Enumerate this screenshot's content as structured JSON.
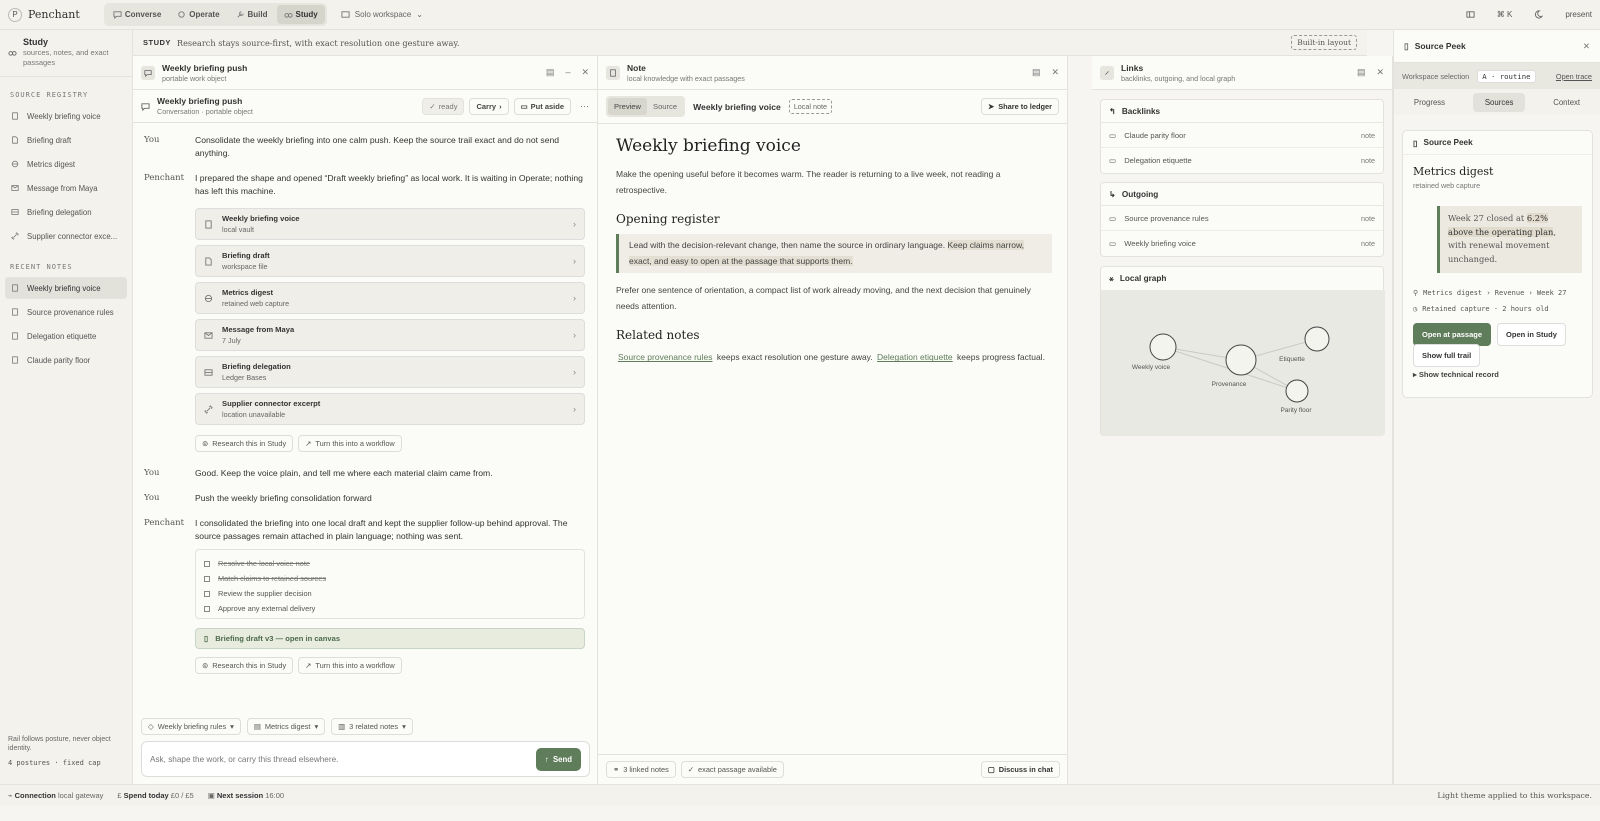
{
  "topbar": {
    "brand_mark": "P",
    "brand": "Penchant",
    "modes": [
      "Converse",
      "Operate",
      "Build",
      "Study"
    ],
    "active_mode": "Study",
    "workspace": "Solo workspace",
    "shortcut": "⌘ K",
    "present": "present"
  },
  "leftnav": {
    "title": "Study",
    "subtitle": "sources, notes, and exact passages",
    "registry_heading": "SOURCE REGISTRY",
    "registry": [
      {
        "label": "Weekly briefing voice",
        "icon": "note-icon"
      },
      {
        "label": "Briefing draft",
        "icon": "file-icon"
      },
      {
        "label": "Metrics digest",
        "icon": "globe-icon"
      },
      {
        "label": "Message from Maya",
        "icon": "mail-icon"
      },
      {
        "label": "Briefing delegation",
        "icon": "table-icon"
      },
      {
        "label": "Supplier connector exce...",
        "icon": "link-icon"
      }
    ],
    "recent_heading": "RECENT NOTES",
    "recent": [
      {
        "label": "Weekly briefing voice",
        "active": true
      },
      {
        "label": "Source provenance rules"
      },
      {
        "label": "Delegation etiquette"
      },
      {
        "label": "Claude parity floor"
      }
    ],
    "foot_text": "Rail follows posture, never object identity.",
    "foot_mono": "4 postures · fixed cap"
  },
  "studybar": {
    "label": "STUDY",
    "text": "Research stays source-first, with exact resolution one gesture away.",
    "badge": "Built-in layout"
  },
  "chat": {
    "panel_title": "Weekly briefing push",
    "panel_sub": "portable work object",
    "conv_title": "Weekly briefing push",
    "conv_sub": "Conversation · portable object",
    "ready": "ready",
    "carry": "Carry",
    "put_aside": "Put aside",
    "messages": [
      {
        "who": "You",
        "text": "Consolidate the weekly briefing into one calm push. Keep the source trail exact and do not send anything."
      },
      {
        "who": "Penchant",
        "text": "I prepared the shape and opened “Draft weekly briefing” as local work. It is waiting in Operate; nothing has left this machine."
      },
      {
        "who": "You",
        "text": "Good. Keep the voice plain, and tell me where each material claim came from."
      },
      {
        "who": "You",
        "text": "Push the weekly briefing consolidation forward"
      },
      {
        "who": "Penchant",
        "text": "I consolidated the briefing into one local draft and kept the supplier follow-up behind approval. The source passages remain attached in plain language; nothing was sent."
      }
    ],
    "cards": [
      {
        "title": "Weekly briefing voice",
        "sub": "local vault"
      },
      {
        "title": "Briefing draft",
        "sub": "workspace file"
      },
      {
        "title": "Metrics digest",
        "sub": "retained web capture"
      },
      {
        "title": "Message from Maya",
        "sub": "7 July"
      },
      {
        "title": "Briefing delegation",
        "sub": "Ledger Bases"
      },
      {
        "title": "Supplier connector excerpt",
        "sub": "location unavailable"
      }
    ],
    "research": "Research this in Study",
    "workflow": "Turn this into a workflow",
    "tasks": [
      {
        "label": "Resolve the local voice note",
        "done": true
      },
      {
        "label": "Match claims to retained sources",
        "done": true
      },
      {
        "label": "Review the supplier decision",
        "done": false
      },
      {
        "label": "Approve any external delivery",
        "done": false
      }
    ],
    "artifact": "Briefing draft v3 — open in canvas",
    "context_chips": [
      "Weekly briefing rules",
      "Metrics digest",
      "3 related notes"
    ],
    "composer_placeholder": "Ask, shape the work, or carry this thread elsewhere.",
    "send": "Send"
  },
  "note": {
    "panel_title": "Note",
    "panel_sub": "local knowledge with exact passages",
    "tab_preview": "Preview",
    "tab_source": "Source",
    "title_small": "Weekly briefing voice",
    "local_note": "Local note",
    "share": "Share to ledger",
    "h1": "Weekly briefing voice",
    "intro": "Make the opening useful before it becomes warm. The reader is returning to a live week, not reading a retrospective.",
    "h2_register": "Opening register",
    "quote_plain": "Lead with the decision-relevant change, then name the source in ordinary language.",
    "quote_hl": "Keep claims narrow, exact, and easy to open at the passage that supports them.",
    "para2": "Prefer one sentence of orientation, a compact list of work already moving, and the next decision that genuinely needs attention.",
    "h2_related": "Related notes",
    "rel_link1": "Source provenance rules",
    "rel_text1": "keeps exact resolution one gesture away.",
    "rel_link2": "Delegation etiquette",
    "rel_text2": "keeps progress factual.",
    "foot_linked": "3 linked notes",
    "foot_exact": "exact passage available",
    "discuss": "Discuss in chat"
  },
  "links": {
    "panel_title": "Links",
    "panel_sub": "backlinks, outgoing, and local graph",
    "backlinks_title": "Backlinks",
    "backlinks": [
      {
        "label": "Claude parity floor",
        "tag": "note"
      },
      {
        "label": "Delegation etiquette",
        "tag": "note"
      }
    ],
    "outgoing_title": "Outgoing",
    "outgoing": [
      {
        "label": "Source provenance rules",
        "tag": "note"
      },
      {
        "label": "Weekly briefing voice",
        "tag": "note"
      }
    ],
    "graph_title": "Local graph",
    "graph_nodes": [
      "Weekly voice",
      "Provenance",
      "Etiquette",
      "Parity floor"
    ]
  },
  "peek": {
    "title": "Source Peek",
    "ws_label": "Workspace selection",
    "ws_pill": "A · routine",
    "open_trace": "Open trace",
    "tabs": [
      "Progress",
      "Sources",
      "Context"
    ],
    "active_tab": "Sources",
    "card_title": "Source Peek",
    "source_title": "Metrics digest",
    "source_sub": "retained web capture",
    "quote_pre": "Week 27 closed at ",
    "quote_hl": "6.2% above the operating plan",
    "quote_post": ", with renewal movement unchanged.",
    "crumb": "Metrics digest › Revenue › Week 27",
    "retained": "Retained capture · 2 hours old",
    "open_passage": "Open at passage",
    "open_study": "Open in Study",
    "full_trail": "Show full trail",
    "tech": "Show technical record"
  },
  "status": {
    "connection_label": "Connection",
    "connection_value": "local gateway",
    "spend_label": "Spend today",
    "spend_value": "£0 / £5",
    "session_label": "Next session",
    "session_value": "16:00",
    "theme_note": "Light theme applied to this workspace."
  },
  "colors": {
    "accent": "#5f7d5a",
    "background": "#f6f5f1"
  }
}
